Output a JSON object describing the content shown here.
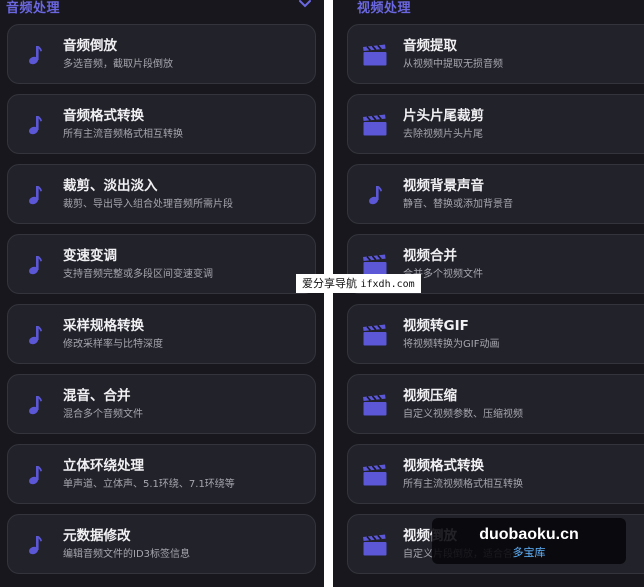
{
  "left": {
    "section_title": "音频处理",
    "items": [
      {
        "title": "音频倒放",
        "subtitle": "多选音频，截取片段倒放",
        "icon": "music-note-icon"
      },
      {
        "title": "音频格式转换",
        "subtitle": "所有主流音频格式相互转换",
        "icon": "music-note-icon"
      },
      {
        "title": "裁剪、淡出淡入",
        "subtitle": "裁剪、导出导入组合处理音频所需片段",
        "icon": "music-note-icon"
      },
      {
        "title": "变速变调",
        "subtitle": "支持音频完整或多段区间变速变调",
        "icon": "music-note-icon"
      },
      {
        "title": "采样规格转换",
        "subtitle": "修改采样率与比特深度",
        "icon": "music-note-icon"
      },
      {
        "title": "混音、合并",
        "subtitle": "混合多个音频文件",
        "icon": "music-note-icon"
      },
      {
        "title": "立体环绕处理",
        "subtitle": "单声道、立体声、5.1环绕、7.1环绕等",
        "icon": "music-note-icon"
      },
      {
        "title": "元数据修改",
        "subtitle": "编辑音频文件的ID3标签信息",
        "icon": "music-note-icon"
      }
    ]
  },
  "right": {
    "section_title": "视频处理",
    "items": [
      {
        "title": "音频提取",
        "subtitle": "从视频中提取无损音频",
        "icon": "clapperboard-icon"
      },
      {
        "title": "片头片尾裁剪",
        "subtitle": "去除视频片头片尾",
        "icon": "clapperboard-icon"
      },
      {
        "title": "视频背景声音",
        "subtitle": "静音、替换或添加背景音",
        "icon": "music-note-icon"
      },
      {
        "title": "视频合并",
        "subtitle": "合并多个视频文件",
        "icon": "clapperboard-icon"
      },
      {
        "title": "视频转GIF",
        "subtitle": "将视频转换为GIF动画",
        "icon": "clapperboard-icon"
      },
      {
        "title": "视频压缩",
        "subtitle": "自定义视频参数、压缩视频",
        "icon": "clapperboard-icon"
      },
      {
        "title": "视频格式转换",
        "subtitle": "所有主流视频格式相互转换",
        "icon": "clapperboard-icon"
      },
      {
        "title": "视频倒放",
        "subtitle": "自定义片段倒放，适合各种需求",
        "icon": "clapperboard-icon"
      }
    ]
  },
  "watermark": {
    "text": "爱分享导航",
    "domain": "ifxdh.com"
  },
  "logo": {
    "domain": "duobaoku.cn",
    "brand": "多宝库"
  },
  "colors": {
    "accent": "#5b57d6",
    "panel_bg": "#17171d",
    "card_bg": "#22222a"
  }
}
